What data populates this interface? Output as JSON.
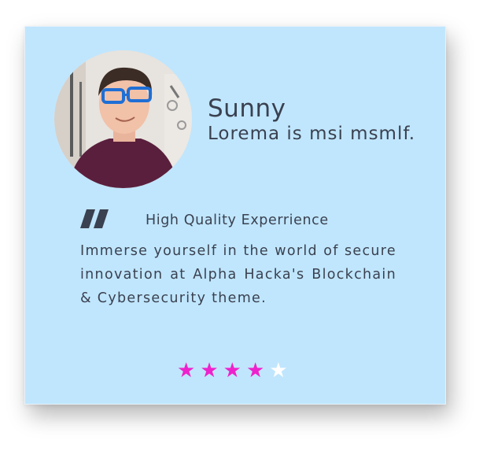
{
  "card": {
    "name": "Sunny",
    "subtitle": "Lorema is msi msmlf.",
    "headline": "High Quality Experrience",
    "body": "Immerse yourself in the world of secure innovation at Alpha Hacka's Blockchain & Cybersecurity theme.",
    "avatar_icon": "person-photo",
    "quote_icon": "quote-mark-icon"
  },
  "rating": {
    "value": 4,
    "max": 5,
    "filled_color": "#ee22cc",
    "empty_color": "#ffffff"
  },
  "colors": {
    "card_background": "#c0e6fd",
    "text": "#3a4150"
  }
}
